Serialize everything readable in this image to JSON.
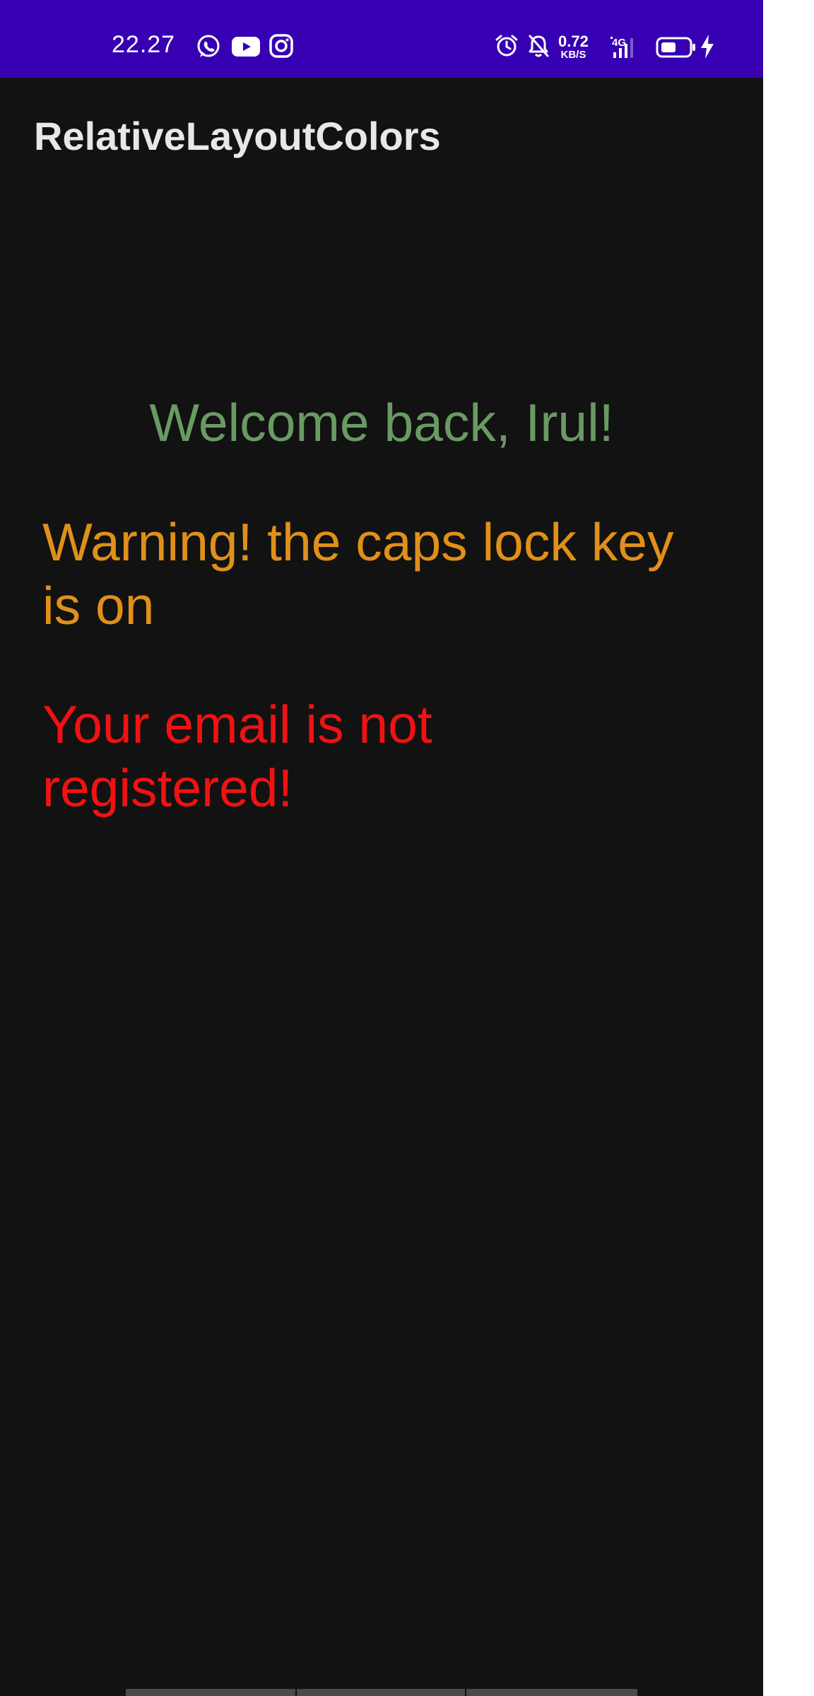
{
  "status_bar": {
    "time": "22.27",
    "notification_icons": [
      "whatsapp-icon",
      "youtube-icon",
      "instagram-icon"
    ],
    "system_icons": [
      "alarm-icon",
      "silent-bell-icon",
      "signal-4g-icon",
      "battery-icon",
      "charging-bolt-icon"
    ],
    "net_speed_value": "0.72",
    "net_speed_unit": "KB/S",
    "network_label": "4G",
    "background_color": "#3700b3"
  },
  "app_bar": {
    "title": "RelativeLayoutColors"
  },
  "content": {
    "welcome": "Welcome back, Irul!",
    "warning": "Warning! the caps lock key is on",
    "error": "Your email is not registered!"
  },
  "colors": {
    "background": "#121212",
    "welcome": "#6a9a64",
    "warning": "#e0901a",
    "error": "#f01212"
  }
}
